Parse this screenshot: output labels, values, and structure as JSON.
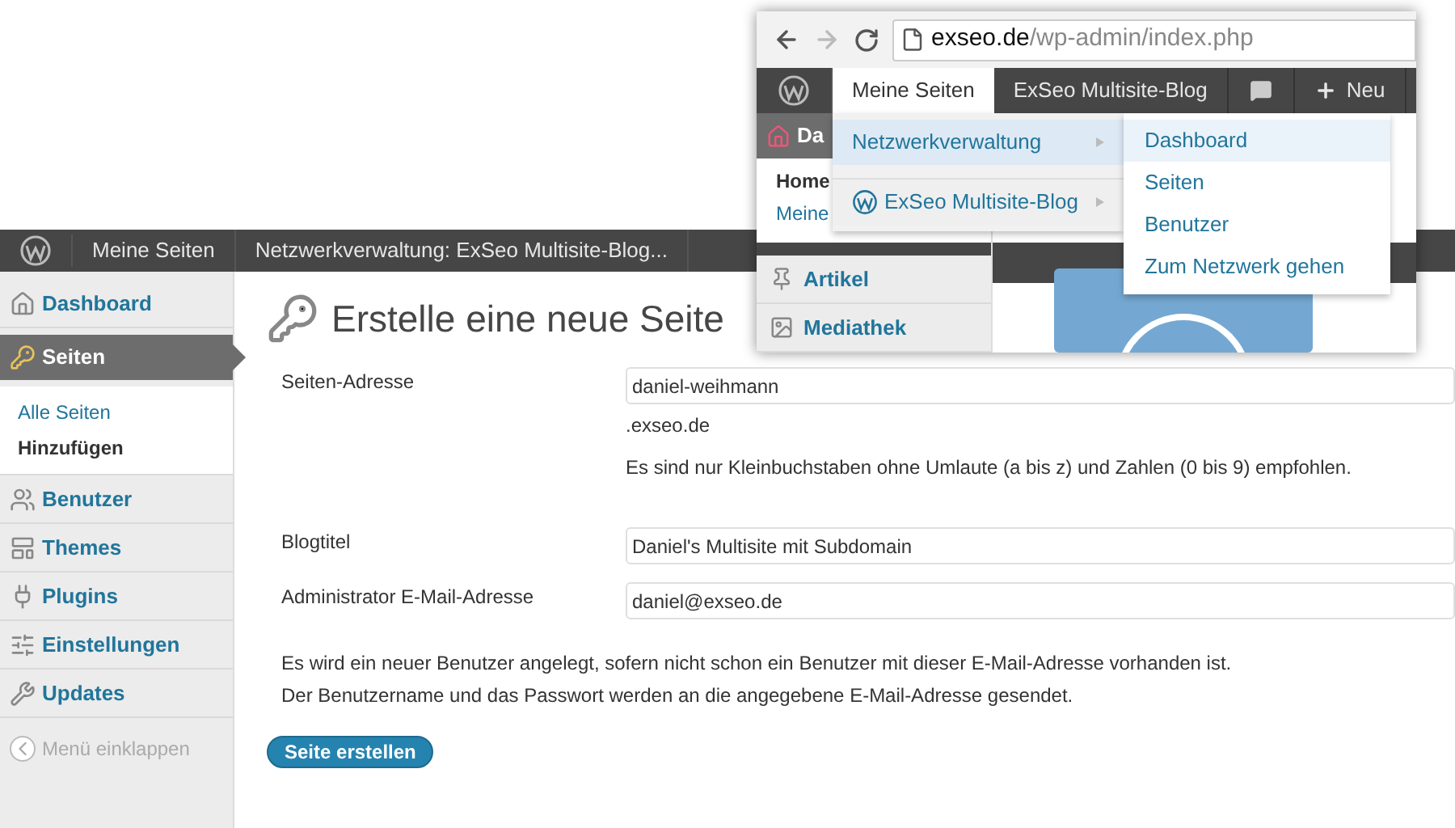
{
  "admin_bar": {
    "items": [
      {
        "label": "Meine Seiten"
      },
      {
        "label": "Netzwerkverwaltung: ExSeo Multisite-Blog..."
      }
    ]
  },
  "sidebar": {
    "items": [
      {
        "label": "Dashboard",
        "selected": false
      },
      {
        "label": "Seiten",
        "selected": true,
        "children": [
          {
            "label": "Alle Seiten",
            "selected": false
          },
          {
            "label": "Hinzufügen",
            "selected": true
          }
        ]
      },
      {
        "label": "Benutzer",
        "selected": false
      },
      {
        "label": "Themes",
        "selected": false
      },
      {
        "label": "Plugins",
        "selected": false
      },
      {
        "label": "Einstellungen",
        "selected": false
      },
      {
        "label": "Updates",
        "selected": false
      }
    ],
    "collapse": "Menü einklappen"
  },
  "page": {
    "title": "Erstelle eine neue Seite",
    "fields": [
      {
        "label": "Seiten-Adresse",
        "value": "daniel-weihmann",
        "notes": [
          ".exseo.de",
          "Es sind nur Kleinbuchstaben ohne Umlaute (a bis z) und Zahlen (0 bis 9) empfohlen."
        ]
      },
      {
        "label": "Blogtitel",
        "value": "Daniel's Multisite mit Subdomain"
      },
      {
        "label": "Administrator E-Mail-Adresse",
        "value": "daniel@exseo.de"
      }
    ],
    "notice": [
      "Es wird ein neuer Benutzer angelegt, sofern nicht schon ein Benutzer mit dieser E-Mail-Adresse vorhanden ist.",
      "Der Benutzername und das Passwort werden an die angegebene E-Mail-Adresse gesendet."
    ],
    "submit": "Seite erstellen"
  },
  "inset": {
    "url": {
      "domain": "exseo.de",
      "path": "/wp-admin/index.php"
    },
    "admin_bar": [
      {
        "label": "Meine Seiten",
        "selected": true,
        "kind": "text"
      },
      {
        "label": "ExSeo Multisite-Blog",
        "selected": false,
        "kind": "text"
      },
      {
        "kind": "comments",
        "selected": false
      },
      {
        "label": "Neu",
        "selected": false,
        "kind": "new"
      }
    ],
    "dropdown": [
      {
        "label": "Netzwerkverwaltung",
        "selected": true,
        "kind": "text"
      },
      {
        "label": "ExSeo Multisite-Blog",
        "selected": false,
        "kind": "site"
      }
    ],
    "submenu": [
      {
        "label": "Dashboard",
        "selected": true
      },
      {
        "label": "Seiten",
        "selected": false
      },
      {
        "label": "Benutzer",
        "selected": false
      },
      {
        "label": "Zum Netzwerk gehen",
        "selected": false
      }
    ],
    "sidebar": [
      {
        "label": "Da",
        "selected": true,
        "children": [
          "Home",
          "Meine"
        ]
      },
      {
        "label": "Artikel",
        "selected": false
      },
      {
        "label": "Mediathek",
        "selected": false
      }
    ]
  }
}
